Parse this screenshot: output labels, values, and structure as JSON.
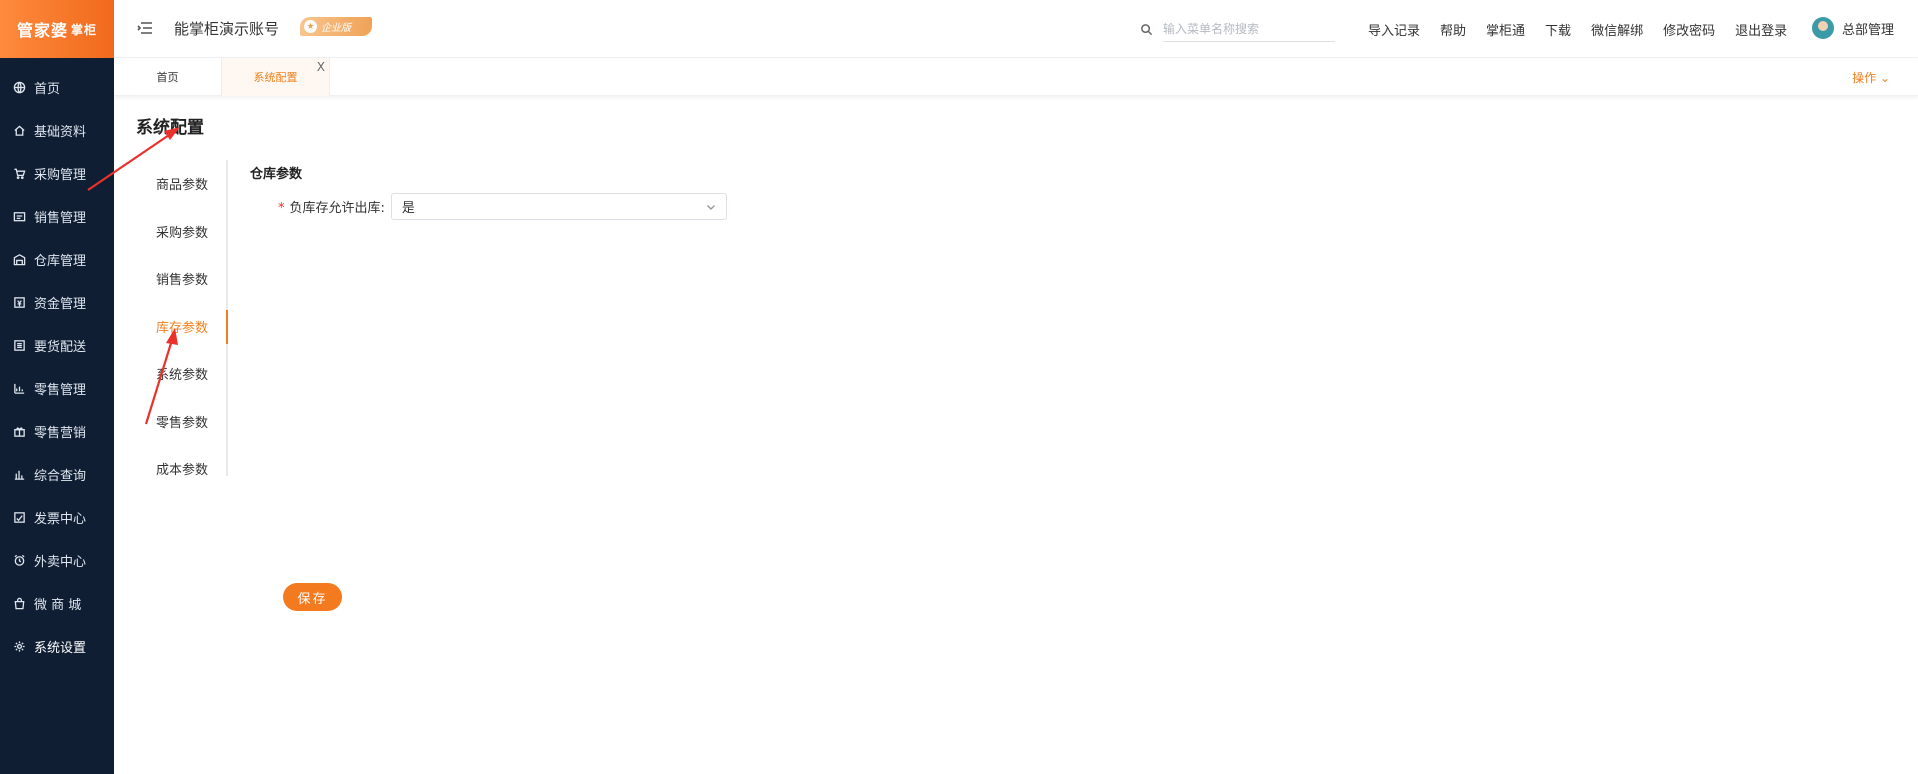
{
  "sidebar": {
    "logo_main": "管家婆",
    "logo_sub": "掌柜",
    "items": [
      {
        "label": "首页",
        "icon": "globe-icon"
      },
      {
        "label": "基础资料",
        "icon": "home-icon"
      },
      {
        "label": "采购管理",
        "icon": "cart-icon"
      },
      {
        "label": "销售管理",
        "icon": "sales-icon"
      },
      {
        "label": "仓库管理",
        "icon": "warehouse-icon"
      },
      {
        "label": "资金管理",
        "icon": "wallet-icon"
      },
      {
        "label": "要货配送",
        "icon": "delivery-icon"
      },
      {
        "label": "零售管理",
        "icon": "retail-chart-icon"
      },
      {
        "label": "零售营销",
        "icon": "gift-icon"
      },
      {
        "label": "综合查询",
        "icon": "bar-chart-icon"
      },
      {
        "label": "发票中心",
        "icon": "invoice-icon"
      },
      {
        "label": "外卖中心",
        "icon": "alarm-icon"
      },
      {
        "label": "微 商 城",
        "icon": "shop-bag-icon"
      },
      {
        "label": "系统设置",
        "icon": "gear-icon"
      }
    ]
  },
  "header": {
    "account_name": "能掌柜演示账号",
    "edition_badge": "企业版",
    "search_placeholder": "输入菜单名称搜索",
    "links": [
      "导入记录",
      "帮助",
      "掌柜通",
      "下载",
      "微信解绑",
      "修改密码",
      "退出登录"
    ],
    "user_name": "总部管理"
  },
  "tabs": {
    "home": "首页",
    "current": "系统配置",
    "close_glyph": "X",
    "operate": "操作"
  },
  "page": {
    "title": "系统配置",
    "subnav": [
      "商品参数",
      "采购参数",
      "销售参数",
      "库存参数",
      "系统参数",
      "零售参数",
      "成本参数"
    ],
    "active_subnav": "库存参数",
    "section_title": "仓库参数",
    "field": {
      "required_mark": "*",
      "label": "负库存允许出库:",
      "value": "是"
    },
    "save_label": "保存"
  },
  "colors": {
    "accent": "#f0801e",
    "sidebar_bg": "#0f1e33",
    "required": "#e62e2e"
  }
}
